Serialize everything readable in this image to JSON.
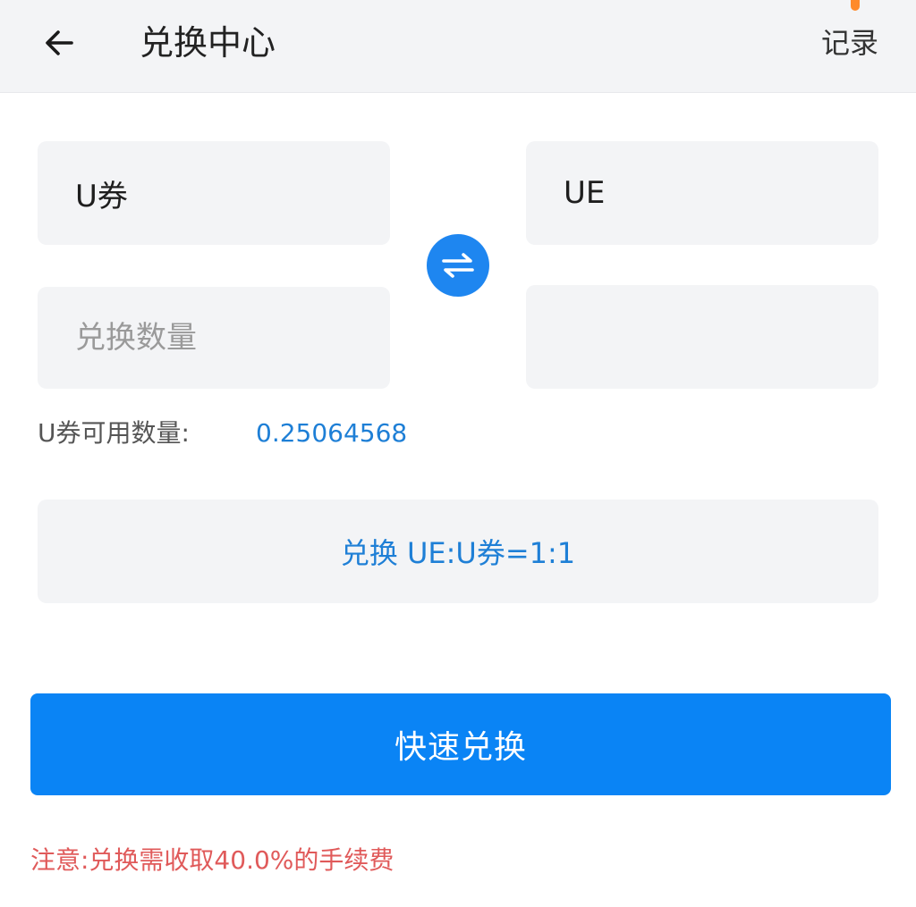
{
  "header": {
    "title": "兑换中心",
    "records_label": "记录"
  },
  "exchange": {
    "from_currency": "U券",
    "to_currency": "UE",
    "amount_placeholder": "兑换数量",
    "result_value": "",
    "available_label": "U券可用数量:",
    "available_value": "0.25064568",
    "rate_text": "兑换  UE:U券=1:1",
    "submit_label": "快速兑换",
    "notice": "注意:兑换需收取40.0%的手续费"
  },
  "colors": {
    "primary": "#0a84f5",
    "link_blue": "#1e7fd6",
    "warning_red": "#e05a5a",
    "box_bg": "#f3f4f6",
    "header_bg": "#f3f4f6"
  },
  "icons": {
    "back": "arrow-left-icon",
    "swap": "swap-arrows-icon"
  }
}
